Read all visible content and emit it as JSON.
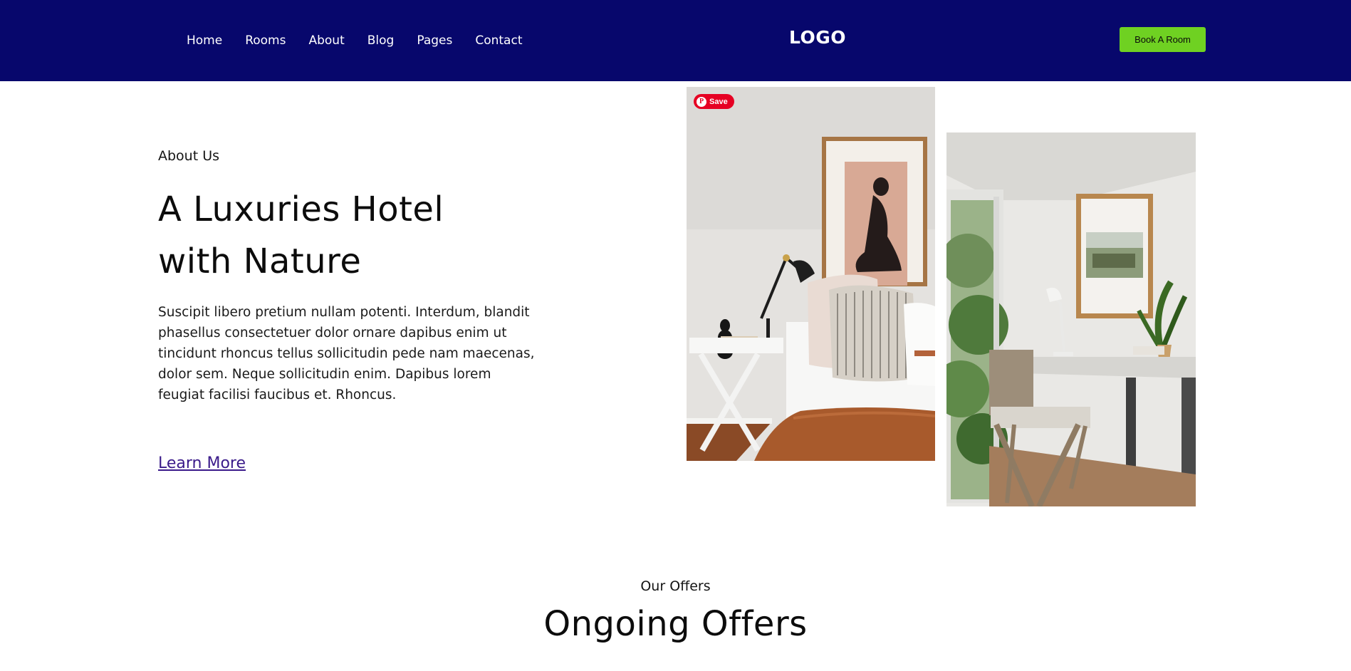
{
  "header": {
    "nav": [
      "Home",
      "Rooms",
      "About",
      "Blog",
      "Pages",
      "Contact"
    ],
    "logo": "LOGO",
    "cta_label": "Book A Room",
    "background_color": "#07076c",
    "cta_color": "#6fd122"
  },
  "about": {
    "eyebrow": "About Us",
    "title_line1": "A Luxuries Hotel",
    "title_line2": "with Nature",
    "body": "Suscipit libero pretium nullam potenti. Interdum, blandit phasellus consectetuer dolor ornare dapibus enim ut tincidunt rhoncus tellus sollicitudin pede nam maecenas, dolor sem. Neque sollicitudin enim. Dapibus lorem feugiat facilisi faucibus et. Rhoncus.",
    "link_label": "Learn More"
  },
  "photos": {
    "save_label": "Save",
    "save_icon": "pinterest-icon"
  },
  "offers": {
    "eyebrow": "Our Offers",
    "title": "Ongoing Offers"
  }
}
